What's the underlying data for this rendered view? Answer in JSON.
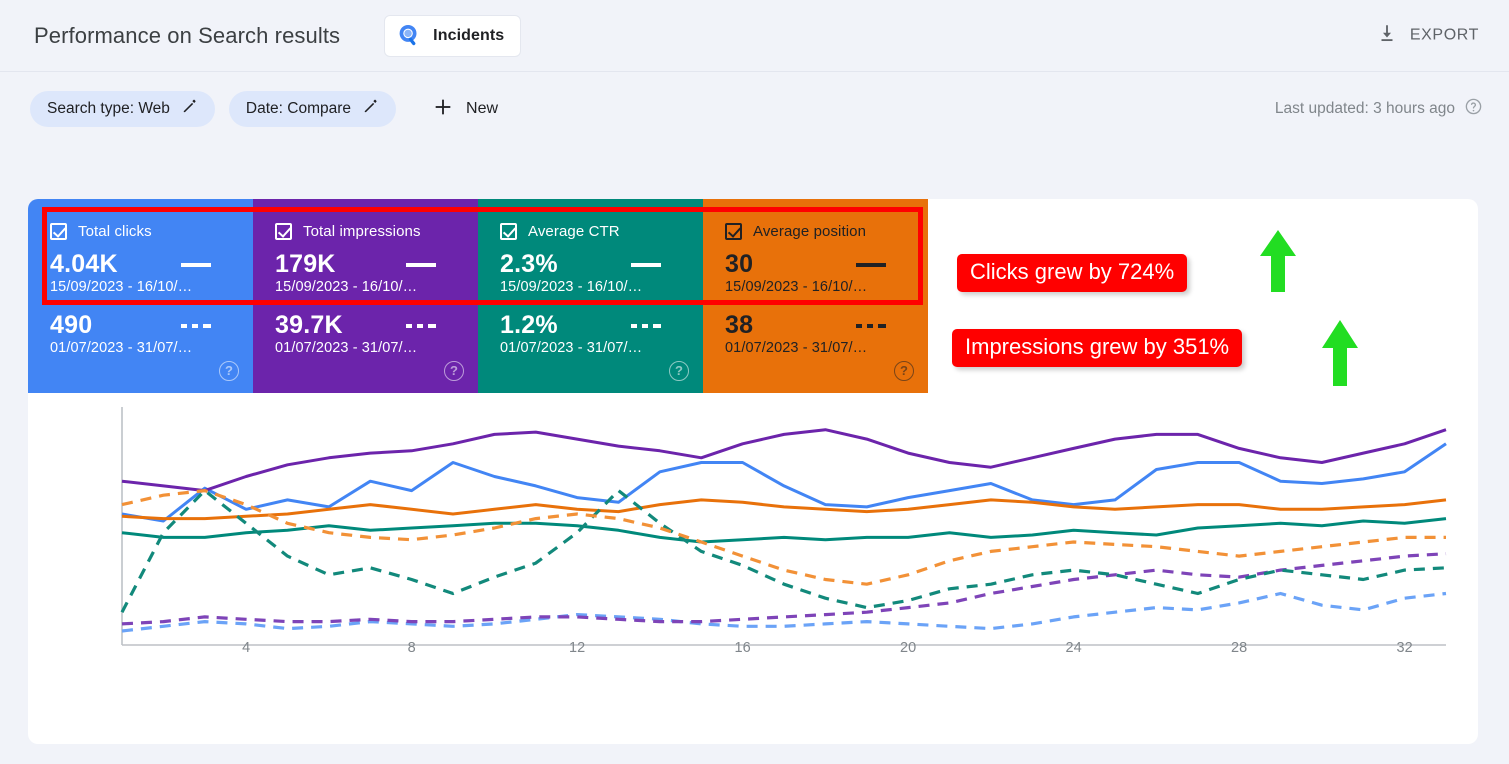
{
  "header": {
    "title": "Performance on Search results",
    "property_chip": {
      "label": "Incidents",
      "icon": "search-console-logo-icon"
    },
    "export": {
      "label": "EXPORT",
      "icon": "download-icon"
    }
  },
  "filters": {
    "chips": [
      {
        "label": "Search type: Web",
        "icon": "pencil-icon"
      },
      {
        "label": "Date: Compare",
        "icon": "pencil-icon"
      }
    ],
    "new_button": {
      "label": "New",
      "icon": "plus-icon"
    },
    "last_updated": {
      "label": "Last updated: 3 hours ago",
      "icon": "help-icon"
    }
  },
  "metrics": [
    {
      "name": "Total clicks",
      "color": "#4285f4",
      "text_color": "#ffffff",
      "checked": true,
      "current": {
        "value": "4.04K",
        "dates": "15/09/2023 - 16/10/…"
      },
      "compare": {
        "value": "490",
        "dates": "01/07/2023 - 31/07/…"
      }
    },
    {
      "name": "Total impressions",
      "color": "#6c24ab",
      "text_color": "#ffffff",
      "checked": true,
      "current": {
        "value": "179K",
        "dates": "15/09/2023 - 16/10/…"
      },
      "compare": {
        "value": "39.7K",
        "dates": "01/07/2023 - 31/07/…"
      }
    },
    {
      "name": "Average CTR",
      "color": "#00897b",
      "text_color": "#ffffff",
      "checked": true,
      "current": {
        "value": "2.3%",
        "dates": "15/09/2023 - 16/10/…"
      },
      "compare": {
        "value": "1.2%",
        "dates": "01/07/2023 - 31/07/…"
      }
    },
    {
      "name": "Average position",
      "color": "#e8710a",
      "text_color": "#202124",
      "checked": true,
      "current": {
        "value": "30",
        "dates": "15/09/2023 - 16/10/…"
      },
      "compare": {
        "value": "38",
        "dates": "01/07/2023 - 31/07/…"
      }
    }
  ],
  "annotations": {
    "highlight_color": "#ff0000",
    "arrow_color": "#22dd22",
    "badges": [
      {
        "text": "Clicks grew by 724%"
      },
      {
        "text": "Impressions grew by 351%"
      }
    ],
    "arrows": [
      {
        "icon": "up-arrow-icon"
      },
      {
        "icon": "up-arrow-icon"
      }
    ]
  },
  "chart_data": {
    "type": "line",
    "title": "",
    "xlabel": "",
    "ylabel": "",
    "grid": false,
    "legend_position": "none",
    "x": [
      1,
      2,
      3,
      4,
      5,
      6,
      7,
      8,
      9,
      10,
      11,
      12,
      13,
      14,
      15,
      16,
      17,
      18,
      19,
      20,
      21,
      22,
      23,
      24,
      25,
      26,
      27,
      28,
      29,
      30,
      31,
      32,
      33
    ],
    "xticks": [
      4,
      8,
      12,
      16,
      20,
      24,
      28,
      32
    ],
    "xlim": [
      1,
      33
    ],
    "ylim": [
      0,
      100
    ],
    "series": [
      {
        "name": "Total clicks (15/09/2023 - 16/10/…)",
        "color": "#4285f4",
        "style": "solid",
        "values": [
          56,
          53,
          67,
          58,
          62,
          59,
          70,
          66,
          78,
          72,
          68,
          63,
          61,
          74,
          78,
          78,
          68,
          60,
          59,
          63,
          66,
          69,
          62,
          60,
          62,
          75,
          78,
          78,
          70,
          69,
          71,
          74,
          86
        ]
      },
      {
        "name": "Total impressions (15/09/2023 - 16/10/…)",
        "color": "#6c24ab",
        "style": "solid",
        "values": [
          70,
          68,
          66,
          72,
          77,
          80,
          82,
          83,
          86,
          90,
          91,
          88,
          85,
          83,
          80,
          86,
          90,
          92,
          88,
          82,
          78,
          76,
          80,
          84,
          88,
          90,
          90,
          84,
          80,
          78,
          82,
          86,
          92
        ]
      },
      {
        "name": "Average CTR (15/09/2023 - 16/10/…)",
        "color": "#00897b",
        "style": "solid",
        "values": [
          48,
          46,
          46,
          48,
          49,
          51,
          49,
          50,
          51,
          52,
          52,
          51,
          49,
          46,
          44,
          45,
          46,
          45,
          46,
          46,
          48,
          46,
          47,
          49,
          48,
          47,
          50,
          51,
          52,
          51,
          53,
          52,
          54
        ]
      },
      {
        "name": "Average position (15/09/2023 - 16/10/…)",
        "color": "#e8710a",
        "style": "solid",
        "values": [
          55,
          54,
          54,
          55,
          56,
          58,
          60,
          58,
          56,
          58,
          60,
          58,
          57,
          60,
          62,
          61,
          59,
          58,
          57,
          58,
          60,
          62,
          61,
          59,
          58,
          59,
          60,
          60,
          58,
          58,
          59,
          60,
          62
        ]
      },
      {
        "name": "Total clicks (01/07/2023 - 31/07/…)",
        "color": "#6ba3f7",
        "style": "dashed",
        "values": [
          6,
          8,
          10,
          9,
          7,
          8,
          10,
          9,
          8,
          9,
          11,
          13,
          12,
          11,
          9,
          8,
          8,
          9,
          10,
          9,
          8,
          7,
          9,
          12,
          14,
          16,
          15,
          18,
          22,
          17,
          15,
          20,
          22
        ]
      },
      {
        "name": "Total impressions (01/07/2023 - 31/07/…)",
        "color": "#7e44b8",
        "style": "dashed",
        "values": [
          9,
          10,
          12,
          11,
          10,
          10,
          11,
          10,
          10,
          11,
          12,
          12,
          11,
          10,
          10,
          11,
          12,
          13,
          14,
          16,
          18,
          22,
          25,
          28,
          30,
          32,
          30,
          29,
          32,
          34,
          36,
          38,
          39
        ]
      },
      {
        "name": "Average CTR (01/07/2023 - 31/07/…)",
        "color": "#12897b",
        "style": "dashed",
        "values": [
          14,
          48,
          66,
          52,
          38,
          30,
          33,
          28,
          22,
          29,
          35,
          48,
          66,
          52,
          40,
          34,
          26,
          20,
          16,
          19,
          24,
          26,
          30,
          32,
          30,
          26,
          22,
          28,
          32,
          30,
          28,
          32,
          33
        ]
      },
      {
        "name": "Average position (01/07/2023 - 31/07/…)",
        "color": "#f29137",
        "style": "dashed",
        "values": [
          60,
          64,
          66,
          60,
          52,
          48,
          46,
          45,
          47,
          50,
          54,
          56,
          54,
          50,
          44,
          38,
          32,
          28,
          26,
          30,
          36,
          40,
          42,
          44,
          43,
          42,
          40,
          38,
          40,
          42,
          44,
          46,
          46
        ]
      }
    ]
  }
}
